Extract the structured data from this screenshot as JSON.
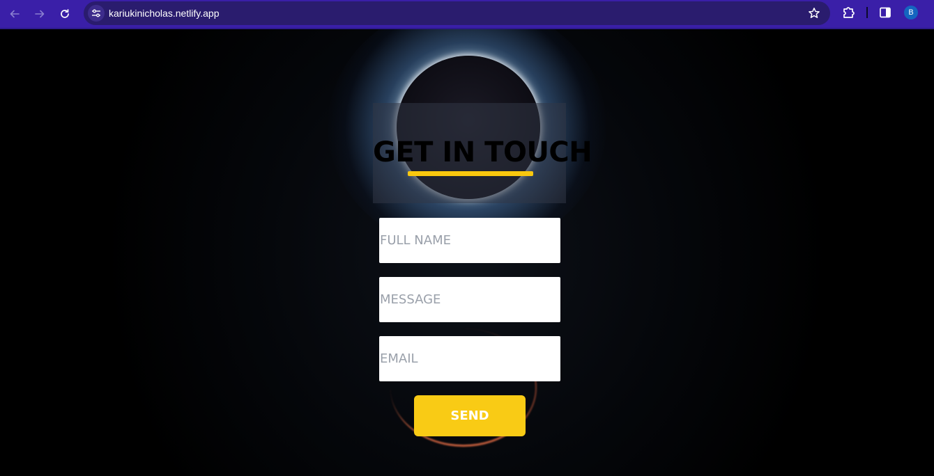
{
  "browser": {
    "url": "kariukinicholas.netlify.app",
    "avatar_letter": "B",
    "icons": {
      "back": "arrow-left-icon",
      "forward": "arrow-right-icon",
      "reload": "reload-icon",
      "site_info": "tune-icon",
      "bookmark": "star-icon",
      "extensions": "puzzle-icon",
      "side_panel": "side-panel-icon"
    },
    "colors": {
      "toolbar": "#3a1fa8",
      "omnibox": "#2a1c6e",
      "avatar": "#1565c0"
    }
  },
  "contact": {
    "title": "GET IN TOUCH",
    "fields": {
      "full_name_placeholder": "FULL NAME",
      "message_placeholder": "MESSAGE",
      "email_placeholder": "EMAIL"
    },
    "send_label": "SEND",
    "accent_color": "#f9c80e"
  }
}
